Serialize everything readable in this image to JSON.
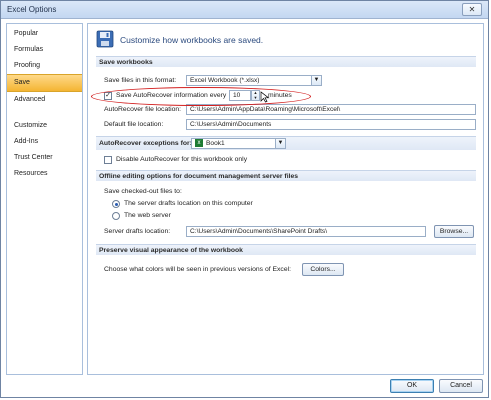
{
  "window": {
    "title": "Excel Options",
    "close_symbol": "✕"
  },
  "sidebar": {
    "items": [
      {
        "label": "Popular"
      },
      {
        "label": "Formulas"
      },
      {
        "label": "Proofing"
      },
      {
        "label": "Save"
      },
      {
        "label": "Advanced"
      },
      {
        "label": "Customize"
      },
      {
        "label": "Add-Ins"
      },
      {
        "label": "Trust Center"
      },
      {
        "label": "Resources"
      }
    ],
    "active": "Save"
  },
  "banner": {
    "text": "Customize how workbooks are saved."
  },
  "save_workbooks": {
    "heading": "Save workbooks",
    "format_label": "Save files in this format:",
    "format_value": "Excel Workbook (*.xlsx)",
    "autorecover_label": "Save AutoRecover information every",
    "autorecover_checked": true,
    "autorecover_minutes": "10",
    "minutes_label": "minutes",
    "autorecover_location_label": "AutoRecover file location:",
    "autorecover_location_value": "C:\\Users\\Admin\\AppData\\Roaming\\Microsoft\\Excel\\",
    "default_location_label": "Default file location:",
    "default_location_value": "C:\\Users\\Admin\\Documents"
  },
  "autorecover_exceptions": {
    "label": "AutoRecover exceptions for:",
    "workbook": "Book1",
    "disable_label": "Disable AutoRecover for this workbook only",
    "disable_checked": false
  },
  "offline_editing": {
    "heading": "Offline editing options for document management server files",
    "save_to_label": "Save checked-out files to:",
    "option_server_drafts": "The server drafts location on this computer",
    "option_web_server": "The web server",
    "selected": "server_drafts",
    "drafts_location_label": "Server drafts location:",
    "drafts_location_value": "C:\\Users\\Admin\\Documents\\SharePoint Drafts\\",
    "browse_label": "Browse..."
  },
  "visual_appearance": {
    "heading": "Preserve visual appearance of the workbook",
    "colors_label": "Choose what colors will be seen in previous versions of Excel:",
    "colors_button": "Colors..."
  },
  "footer": {
    "ok": "OK",
    "cancel": "Cancel"
  },
  "colors": {
    "accent": "#2b4a7e",
    "active_nav": "#f4b533",
    "highlight": "#d21e1e"
  }
}
